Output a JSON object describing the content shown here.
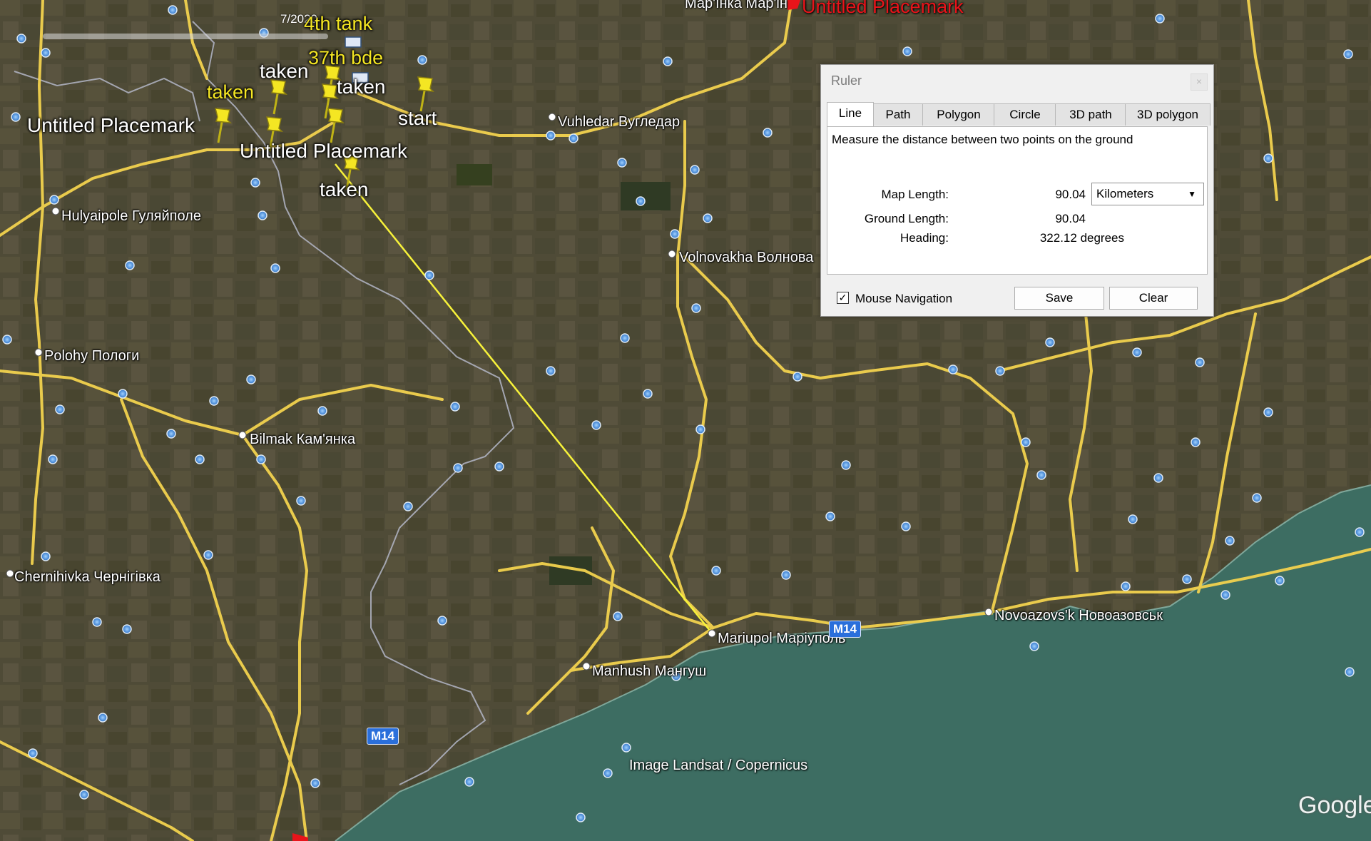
{
  "timeline": {
    "date": "7/2020"
  },
  "placemarks": [
    {
      "id": "4th-tank",
      "text": "4th tank"
    },
    {
      "id": "37th-bde",
      "text": "37th bde"
    },
    {
      "id": "taken-1",
      "text": "taken"
    },
    {
      "id": "taken-2",
      "text": "taken"
    },
    {
      "id": "taken-3",
      "text": "taken"
    },
    {
      "id": "taken-4",
      "text": "taken"
    },
    {
      "id": "start",
      "text": "start"
    },
    {
      "id": "untitled-1",
      "text": "Untitled Placemark"
    },
    {
      "id": "untitled-2",
      "text": "Untitled Placemark"
    },
    {
      "id": "untitled-red",
      "text": "Untitled Placemark"
    }
  ],
  "cities": [
    {
      "id": "marinka",
      "text": "Мар'їнка Мар'ін"
    },
    {
      "id": "vuhledar",
      "text": "Vuhledar Вугледар"
    },
    {
      "id": "hulyaipole",
      "text": "Hulyaipole Гуляйполе"
    },
    {
      "id": "volnovakha",
      "text": "Volnovakha Волнова"
    },
    {
      "id": "polohy",
      "text": "Polohy Пологи"
    },
    {
      "id": "bilmak",
      "text": "Bilmak Кам'янка"
    },
    {
      "id": "chernihivka",
      "text": "Chernihivka Чернігівка"
    },
    {
      "id": "mariupol",
      "text": "Mariupol Маріуполь"
    },
    {
      "id": "manhush",
      "text": "Manhush Мангуш"
    },
    {
      "id": "novoazovsk",
      "text": "Novoazovs'k Новоазовськ"
    }
  ],
  "routes": [
    "M14",
    "M14"
  ],
  "credit": "Image Landsat / Copernicus",
  "google_logo": "Google",
  "ruler": {
    "title": "Ruler",
    "close": "×",
    "tabs": [
      "Line",
      "Path",
      "Polygon",
      "Circle",
      "3D path",
      "3D polygon"
    ],
    "active_tab": "Line",
    "description": "Measure the distance between two points on the ground",
    "map_length_label": "Map Length:",
    "map_length_value": "90.04",
    "unit": "Kilometers",
    "ground_length_label": "Ground Length:",
    "ground_length_value": "90.04",
    "heading_label": "Heading:",
    "heading_value": "322.12 degrees",
    "mouse_nav_label": "Mouse Navigation",
    "mouse_nav_checked": "✓",
    "save_label": "Save",
    "clear_label": "Clear"
  },
  "colors": {
    "land": "#4d4a36",
    "sea": "#3d6d62",
    "road": "#f2d24e",
    "border": "#b9bdd0",
    "ruler_line": "#f7f23a",
    "pin": "#f4e623",
    "poi": "#4a90d9"
  }
}
